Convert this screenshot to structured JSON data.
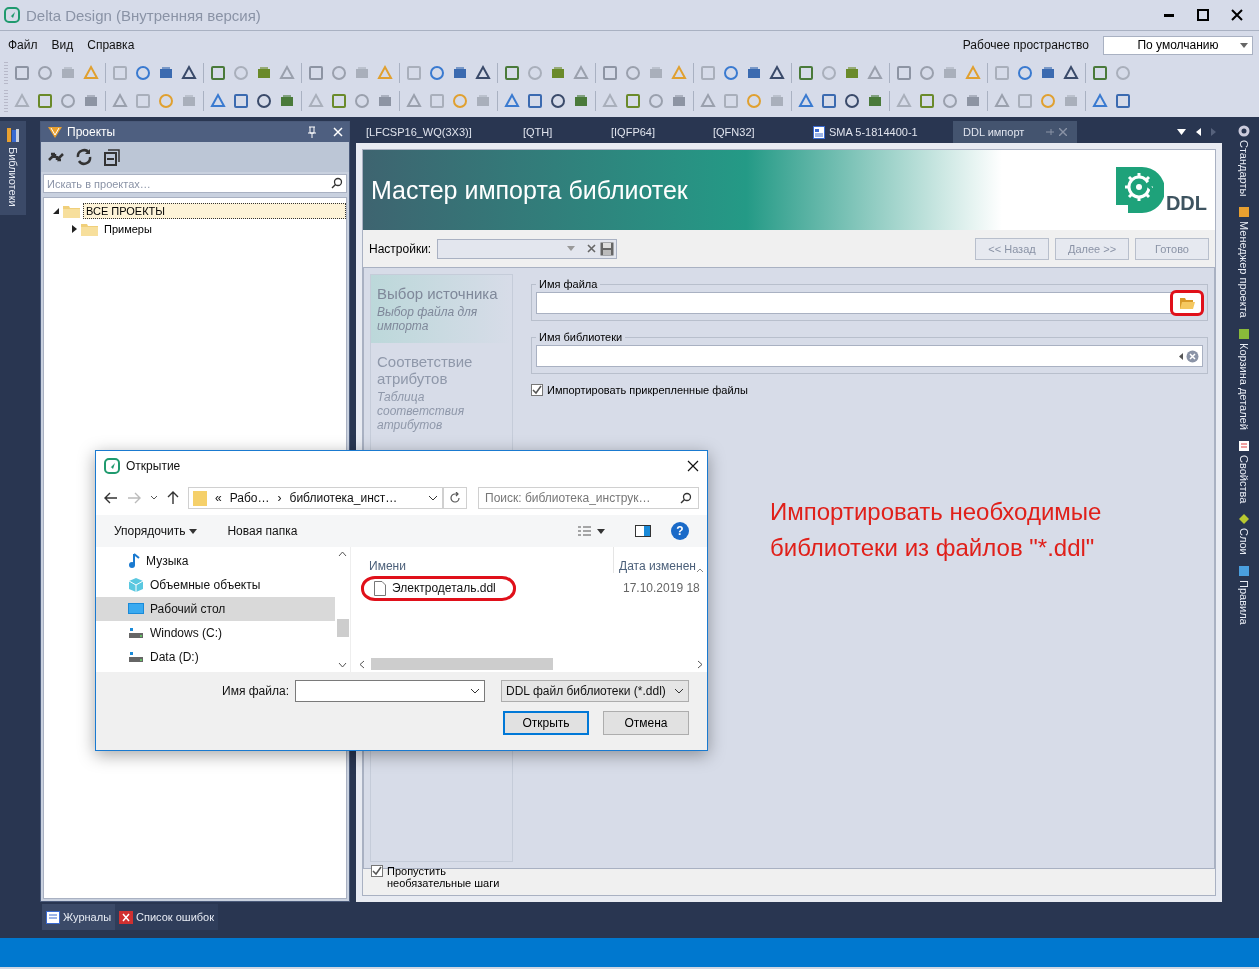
{
  "window": {
    "title": "Delta Design (Внутренняя версия)"
  },
  "menu": [
    {
      "label": "Файл"
    },
    {
      "label": "Вид"
    },
    {
      "label": "Справка"
    }
  ],
  "workspace": {
    "label": "Рабочее пространство",
    "value": "По умолчанию"
  },
  "left_rail": [
    {
      "label": "Библиотеки",
      "selected": true
    }
  ],
  "projects_panel": {
    "title": "Проекты",
    "search": {
      "placeholder": "Искать в проектах…"
    },
    "tree": [
      {
        "label": "ВСЕ ПРОЕКТЫ",
        "selected": true,
        "expanded": true,
        "children": [
          {
            "label": "Примеры",
            "selected": false,
            "expanded": false
          }
        ]
      }
    ]
  },
  "document_tabs": [
    {
      "label": "[LFCSP16_WQ(3X3)]",
      "selected": false,
      "kind": "plain"
    },
    {
      "label": "[QTH]",
      "selected": false,
      "kind": "plain"
    },
    {
      "label": "[IQFP64]",
      "selected": false,
      "kind": "plain"
    },
    {
      "label": "[QFN32]",
      "selected": false,
      "kind": "plain"
    },
    {
      "label": "SMA 5-1814400-1",
      "selected": false,
      "kind": "document"
    },
    {
      "label": "DDL импорт",
      "selected": true,
      "kind": "plain"
    }
  ],
  "wizard": {
    "title": "Мастер импорта библиотек",
    "logo": "DDL",
    "settings_label": "Настройки:",
    "buttons": [
      {
        "label": "<< Назад",
        "disabled": true
      },
      {
        "label": "Далее >>",
        "disabled": true
      },
      {
        "label": "Готово",
        "disabled": true
      }
    ],
    "steps": [
      {
        "title": "Выбор источника",
        "description": "Выбор файла для импорта",
        "selected": true
      },
      {
        "title": "Соответствие атрибутов",
        "description": "Таблица соответствия атрибутов",
        "selected": false
      }
    ],
    "file_field": {
      "label": "Имя файла"
    },
    "library_field": {
      "label": "Имя библиотеки"
    },
    "import_attached": {
      "label": "Импортировать прикрепленные файлы",
      "checked": true
    },
    "skip_optional": {
      "label": "Пропустить необязательные шаги",
      "checked": true
    }
  },
  "annotation": "Импортировать необходимые библиотеки из файлов \"*.ddl\"",
  "right_rail": [
    {
      "label": "Стандарты",
      "selected": false
    },
    {
      "label": "Менеджер проекта",
      "selected": false
    },
    {
      "label": "Корзина деталей",
      "selected": false
    },
    {
      "label": "Свойства",
      "selected": false
    },
    {
      "label": "Слои",
      "selected": false
    },
    {
      "label": "Правила",
      "selected": false
    }
  ],
  "bottom_tabs": [
    {
      "label": "Журналы",
      "selected": true
    },
    {
      "label": "Список ошибок",
      "selected": false
    }
  ],
  "open_dialog": {
    "title": "Открытие",
    "breadcrumb": [
      "«",
      "Рабо…",
      "›",
      "библиотека_инст…"
    ],
    "search": {
      "placeholder": "Поиск: библиотека_инструк…"
    },
    "organize": "Упорядочить",
    "new_folder": "Новая папка",
    "help": "?",
    "nav": [
      {
        "label": "Музыка",
        "selected": false,
        "kind": "music"
      },
      {
        "label": "Объемные объекты",
        "selected": false,
        "kind": "cube"
      },
      {
        "label": "Рабочий стол",
        "selected": true,
        "kind": "desktop"
      },
      {
        "label": "Windows (C:)",
        "selected": false,
        "kind": "drive"
      },
      {
        "label": "Data (D:)",
        "selected": false,
        "kind": "drive"
      }
    ],
    "columns": [
      "Имени",
      "Дата изменен"
    ],
    "files": [
      {
        "name": "Электродеталь.ddl",
        "date": "17.10.2019 18"
      }
    ],
    "file_name_label": "Имя файла:",
    "file_type": "DDL файл библиотеки (*.ddl)",
    "buttons": [
      {
        "label": "Открыть",
        "kind": "primary"
      },
      {
        "label": "Отмена",
        "kind": "normal"
      }
    ]
  }
}
